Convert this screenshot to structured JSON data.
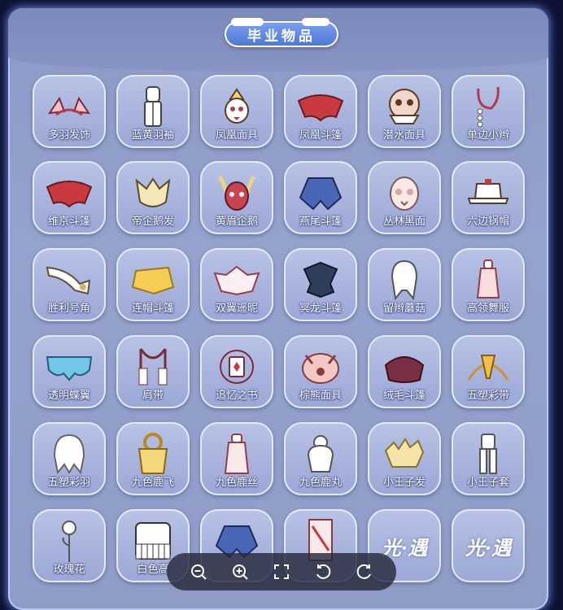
{
  "title": "毕业物品",
  "items": [
    {
      "label": "多羽发饰",
      "icon": "feather-hairpin-icon"
    },
    {
      "label": "蓝黄羽袖",
      "icon": "outfit-icon"
    },
    {
      "label": "凤凰面具",
      "icon": "phoenix-mask-icon"
    },
    {
      "label": "凤凰斗篷",
      "icon": "red-cape-icon"
    },
    {
      "label": "潜水面具",
      "icon": "diving-mask-icon"
    },
    {
      "label": "单边小辫",
      "icon": "braid-icon"
    },
    {
      "label": "维京斗篷",
      "icon": "red-cape-icon"
    },
    {
      "label": "帝企鹅发",
      "icon": "penguin-hair-icon"
    },
    {
      "label": "黄眉企鹅",
      "icon": "penguin-mask-icon"
    },
    {
      "label": "燕尾斗篷",
      "icon": "blue-cape-icon"
    },
    {
      "label": "丛林黑面",
      "icon": "mask-icon"
    },
    {
      "label": "六边锅帽",
      "icon": "hat-icon"
    },
    {
      "label": "胜利号角",
      "icon": "horn-icon"
    },
    {
      "label": "连帽斗篷",
      "icon": "yellow-cape-icon"
    },
    {
      "label": "双翼遥昵",
      "icon": "wing-cape-icon"
    },
    {
      "label": "冥龙斗篷",
      "icon": "dark-cape-icon"
    },
    {
      "label": "留辫蘑菇",
      "icon": "mushroom-hair-icon"
    },
    {
      "label": "高领舞服",
      "icon": "dress-icon"
    },
    {
      "label": "透明蝶翼",
      "icon": "butterfly-cape-icon"
    },
    {
      "label": "肩带",
      "icon": "shoulder-strap-icon"
    },
    {
      "label": "追忆之书",
      "icon": "book-icon"
    },
    {
      "label": "棕熊面具",
      "icon": "bear-mask-icon"
    },
    {
      "label": "绒毛斗篷",
      "icon": "fluffy-cape-icon"
    },
    {
      "label": "五塑彩带",
      "icon": "ribbon-icon"
    },
    {
      "label": "五塑彩羽",
      "icon": "white-hair-icon"
    },
    {
      "label": "九色鹿飞",
      "icon": "deer-cape-icon"
    },
    {
      "label": "九色鹿丝",
      "icon": "deer-outfit-icon"
    },
    {
      "label": "九色鹿丸",
      "icon": "deer-hair-icon"
    },
    {
      "label": "小王子发",
      "icon": "prince-hair-icon"
    },
    {
      "label": "小王子套",
      "icon": "prince-outfit-icon"
    },
    {
      "label": "玫瑰花",
      "icon": "rose-icon"
    },
    {
      "label": "白色高",
      "icon": "piano-icon"
    },
    {
      "label": "",
      "icon": "blue-cape-icon"
    },
    {
      "label": "合",
      "icon": "card-icon"
    },
    {
      "label": "",
      "icon": "sky-logo-icon",
      "logo": "光·遇"
    },
    {
      "label": "",
      "icon": "sky-logo-icon",
      "logo": "光·遇"
    }
  ],
  "toolbar": {
    "zoom_out": "zoom-out-icon",
    "zoom_in": "zoom-in-icon",
    "fullscreen": "fullscreen-icon",
    "rotate_left": "rotate-left-icon",
    "rotate_right": "rotate-right-icon"
  },
  "colors": {
    "accent": "#4d74d4",
    "panel": "#95a2cd",
    "tile": "#a8b3dd"
  }
}
